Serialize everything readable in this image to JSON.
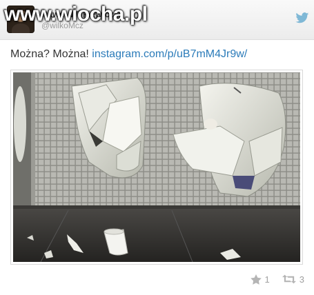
{
  "header": {
    "author_name": "Paweł Wilkiewicz",
    "author_handle": "@wilkoMcz",
    "watermark": "www.wiocha.pl"
  },
  "tweet": {
    "text_prefix": "Można? Można! ",
    "link_text": "instagram.com/p/uB7mM4Jr9w/"
  },
  "actions": {
    "favorites_count": "1",
    "retweets_count": "3"
  },
  "colors": {
    "link": "#2b7bb9",
    "action_gray": "#a0a0a0",
    "bird": "#7fb8d6"
  },
  "icons": [
    "bird-icon",
    "star-icon",
    "retweet-icon"
  ]
}
